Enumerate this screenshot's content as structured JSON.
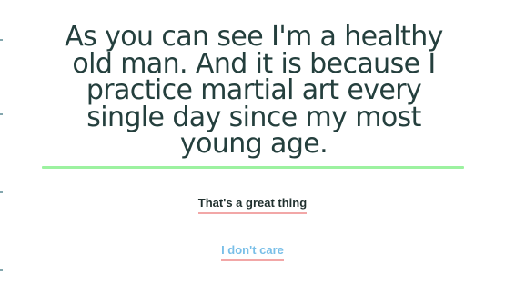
{
  "statement": "As you can see I'm a healthy old man. And it is because I practice martial art every single day since my most young age.",
  "choices": [
    {
      "label": "That's a great thing"
    },
    {
      "label": "I don't care"
    }
  ],
  "colors": {
    "text": "#243f3d",
    "divider": "#9cf2a0",
    "underline": "#f2a7a7",
    "choice_primary": "#1f2f2d",
    "choice_secondary": "#79bfe8"
  }
}
